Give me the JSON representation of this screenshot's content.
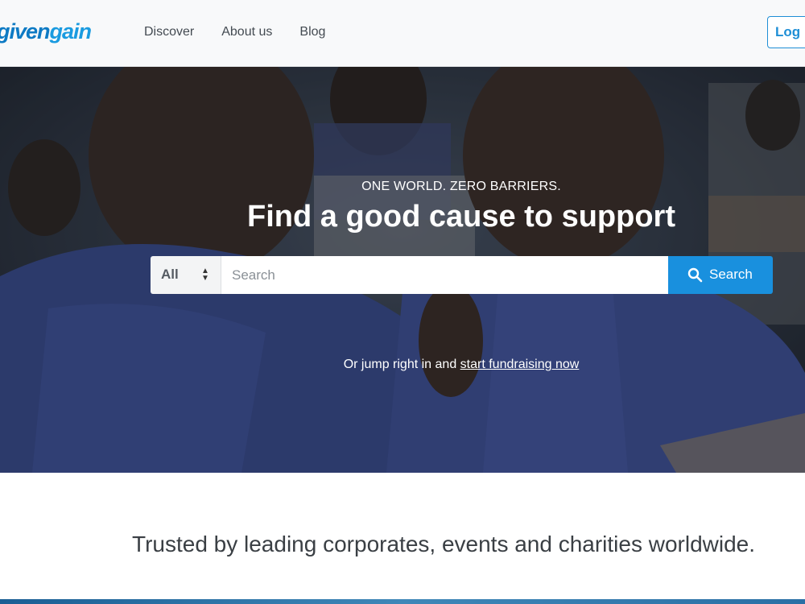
{
  "brand": {
    "logo_part1": "given",
    "logo_part2": "gain"
  },
  "nav": {
    "items": [
      "Discover",
      "About us",
      "Blog"
    ]
  },
  "header": {
    "login_label": "Log in"
  },
  "hero": {
    "tagline": "ONE WORLD. ZERO BARRIERS.",
    "headline": "Find a good cause to support",
    "search": {
      "category_value": "All",
      "placeholder": "Search",
      "button_label": "Search"
    },
    "jump_prefix": "Or jump right in and ",
    "jump_link": "start fundraising now"
  },
  "trusted": {
    "text": "Trusted by leading corporates, events and charities worldwide."
  },
  "colors": {
    "brand_blue": "#1990de",
    "login_blue": "#1f8fd6",
    "text_dark": "#3a3f44"
  },
  "icons": {
    "search": "search-icon",
    "select_arrows": "select-arrows-icon"
  }
}
